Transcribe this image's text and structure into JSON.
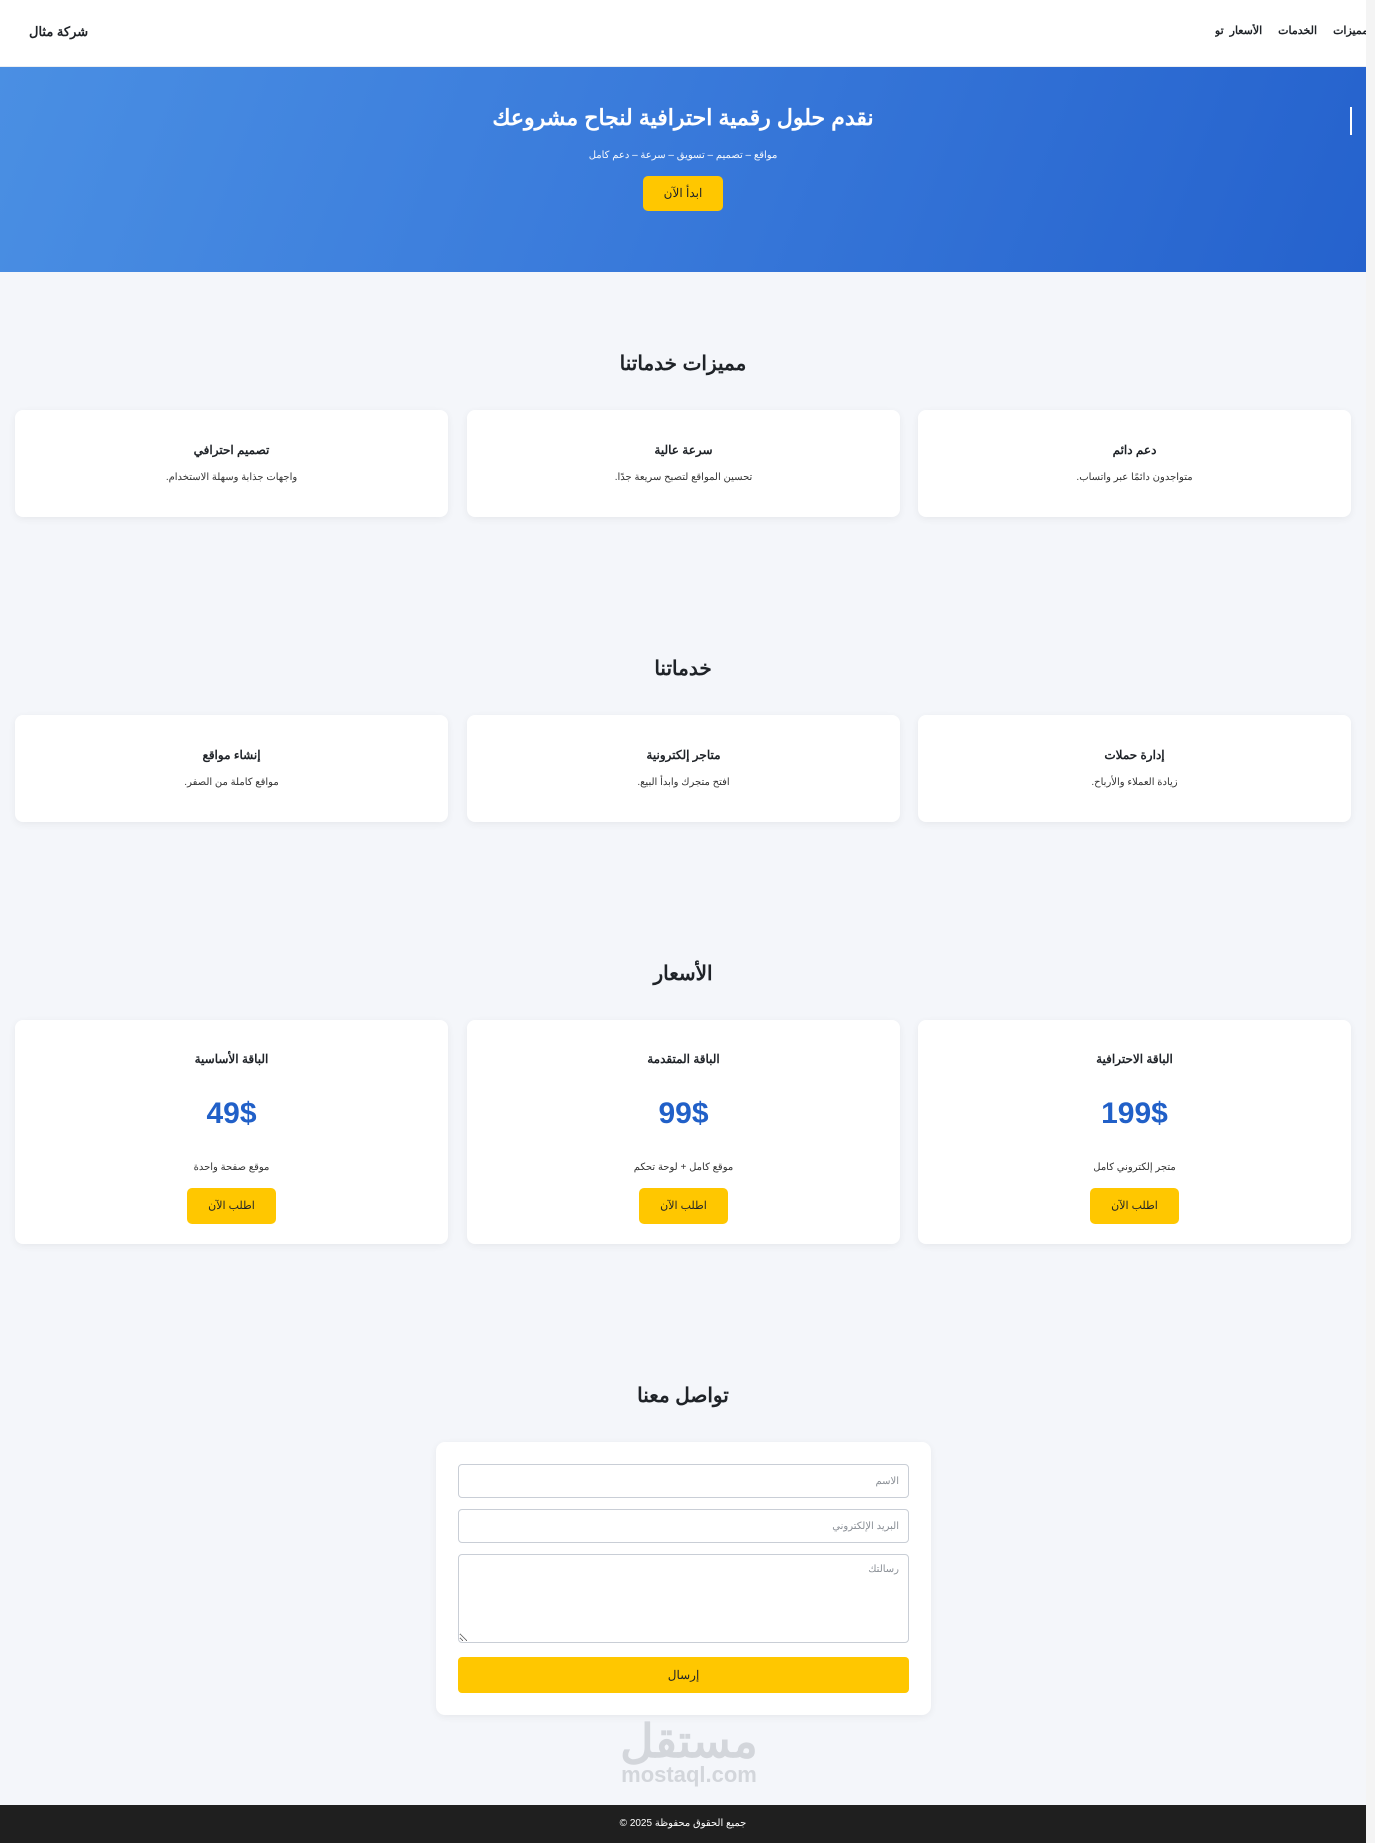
{
  "header": {
    "logo": "شركة مثال",
    "nav": [
      "المميزات",
      "الخدمات",
      "الأسعار",
      "تواصل"
    ]
  },
  "hero": {
    "title": "نقدم حلول رقمية احترافية لنجاح مشروعك",
    "subtitle": "مواقع – تصميم – تسويق – سرعة – دعم كامل",
    "button": "ابدأ الآن"
  },
  "features": {
    "title": "مميزات خدماتنا",
    "items": [
      {
        "title": "دعم دائم",
        "text": "متواجدون دائمًا عبر واتساب."
      },
      {
        "title": "سرعة عالية",
        "text": "تحسين المواقع لتصبح سريعة جدًا."
      },
      {
        "title": "تصميم احترافي",
        "text": "واجهات جذابة وسهلة الاستخدام."
      }
    ]
  },
  "services": {
    "title": "خدماتنا",
    "items": [
      {
        "title": "إدارة حملات",
        "text": "زيادة العملاء والأرباح."
      },
      {
        "title": "متاجر إلكترونية",
        "text": "افتح متجرك وابدأ البيع."
      },
      {
        "title": "إنشاء مواقع",
        "text": "مواقع كاملة من الصفر."
      }
    ]
  },
  "pricing": {
    "title": "الأسعار",
    "items": [
      {
        "title": "الباقة الاحترافية",
        "price": "199$",
        "text": "متجر إلكتروني كامل",
        "button": "اطلب الآن"
      },
      {
        "title": "الباقة المتقدمة",
        "price": "99$",
        "text": "موقع كامل + لوحة تحكم",
        "button": "اطلب الآن"
      },
      {
        "title": "الباقة الأساسية",
        "price": "49$",
        "text": "موقع صفحة واحدة",
        "button": "اطلب الآن"
      }
    ]
  },
  "contact": {
    "title": "تواصل معنا",
    "name_placeholder": "الاسم",
    "email_placeholder": "البريد الإلكتروني",
    "message_placeholder": "رسالتك",
    "submit": "إرسال"
  },
  "watermark": {
    "arabic": "مستقل",
    "latin": "mostaql.com"
  },
  "footer": {
    "text": "جميع الحقوق محفوظة 2025 ©"
  },
  "colors": {
    "accent": "#ffc700",
    "primary": "#2160c8",
    "footer": "#1f1f1f"
  }
}
